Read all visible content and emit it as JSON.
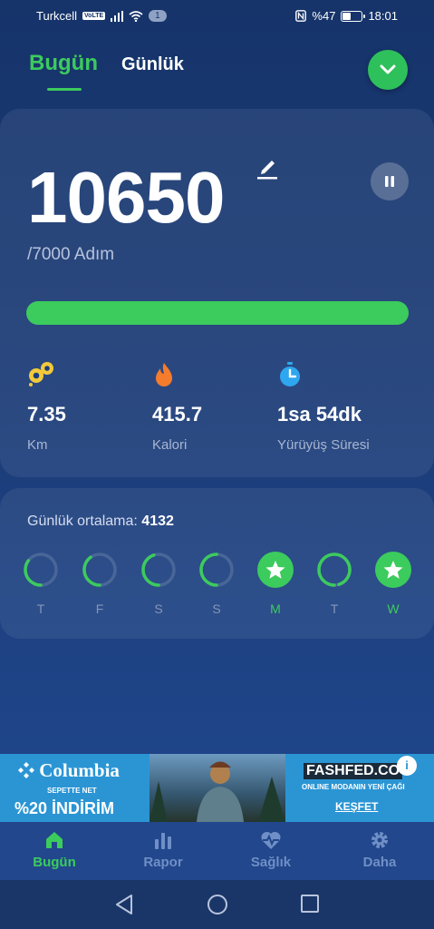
{
  "status_bar": {
    "carrier": "Turkcell",
    "volte": "VoLTE",
    "notification_count": "1",
    "battery": "%47",
    "battery_level": 0.47,
    "time": "18:01"
  },
  "header": {
    "tabs": [
      {
        "label": "Bugün",
        "active": true
      },
      {
        "label": "Günlük",
        "active": false
      }
    ]
  },
  "today": {
    "steps": "10650",
    "goal_text": "/7000 Adım",
    "progress_fraction": 1.0,
    "stats": [
      {
        "icon": "footsteps-icon",
        "value": "7.35",
        "label": "Km"
      },
      {
        "icon": "flame-icon",
        "value": "415.7",
        "label": "Kalori"
      },
      {
        "icon": "stopwatch-icon",
        "value": "1sa 54dk",
        "label": "Yürüyüş Süresi"
      }
    ]
  },
  "weekly": {
    "avg_label": "Günlük ortalama:",
    "avg_value": "4132",
    "days": [
      {
        "label": "T",
        "fraction": 0.35,
        "goal_met": false
      },
      {
        "label": "F",
        "fraction": 0.4,
        "goal_met": false
      },
      {
        "label": "S",
        "fraction": 0.45,
        "goal_met": false
      },
      {
        "label": "S",
        "fraction": 0.5,
        "goal_met": false
      },
      {
        "label": "M",
        "fraction": 1.0,
        "goal_met": true
      },
      {
        "label": "T",
        "fraction": 0.95,
        "goal_met": false
      },
      {
        "label": "W",
        "fraction": 1.0,
        "goal_met": true
      }
    ]
  },
  "ad": {
    "brand": "Columbia",
    "subline": "SEPETTE NET",
    "discount": "%20 İNDİRİM",
    "right_brand": "FASHFED.CO",
    "right_tagline": "ONLINE MODANIN YENİ ÇAĞI",
    "cta": "KEŞFET",
    "info": "i"
  },
  "bottom_nav": [
    {
      "label": "Bugün",
      "icon": "home-icon",
      "active": true
    },
    {
      "label": "Rapor",
      "icon": "bar-chart-icon",
      "active": false
    },
    {
      "label": "Sağlık",
      "icon": "heart-pulse-icon",
      "active": false
    },
    {
      "label": "Daha",
      "icon": "gear-icon",
      "active": false
    }
  ],
  "colors": {
    "accent": "#3ccb5d",
    "background": "#1b3c78"
  }
}
